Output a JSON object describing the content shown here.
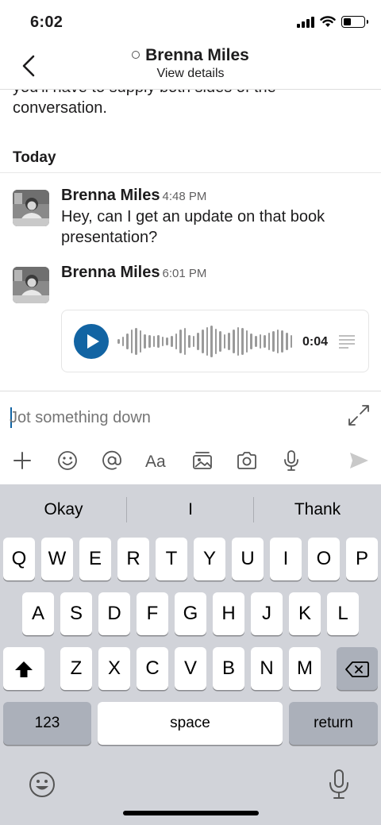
{
  "status_bar": {
    "time": "6:02"
  },
  "header": {
    "back_icon": "chevron-left-icon",
    "name": "Brenna Miles",
    "subtitle": "View details"
  },
  "conversation": {
    "clipped_text": "you'll have to supply both sides of the conversation.",
    "day_label": "Today",
    "messages": [
      {
        "author": "Brenna Miles",
        "time": "4:48 PM",
        "text": "Hey, can I get an update on that book presentation?"
      },
      {
        "author": "Brenna Miles",
        "time": "6:01 PM",
        "text": ""
      }
    ],
    "audio": {
      "duration": "0:04",
      "progress": 0,
      "play_color": "#1264a3"
    }
  },
  "composer": {
    "placeholder": "Jot something down",
    "tools": [
      "plus-icon",
      "emoji-icon",
      "mention-icon",
      "text-format-icon",
      "gallery-icon",
      "camera-icon",
      "microphone-icon",
      "send-icon"
    ]
  },
  "keyboard": {
    "suggestions": [
      "Okay",
      "I",
      "Thank"
    ],
    "row1": [
      "Q",
      "W",
      "E",
      "R",
      "T",
      "Y",
      "U",
      "I",
      "O",
      "P"
    ],
    "row2": [
      "A",
      "S",
      "D",
      "F",
      "G",
      "H",
      "J",
      "K",
      "L"
    ],
    "row3": [
      "Z",
      "X",
      "C",
      "V",
      "B",
      "N",
      "M"
    ],
    "numbers_label": "123",
    "space_label": "space",
    "return_label": "return"
  },
  "colors": {
    "accent": "#1264a3",
    "keyboard_bg": "#d1d3d9"
  }
}
